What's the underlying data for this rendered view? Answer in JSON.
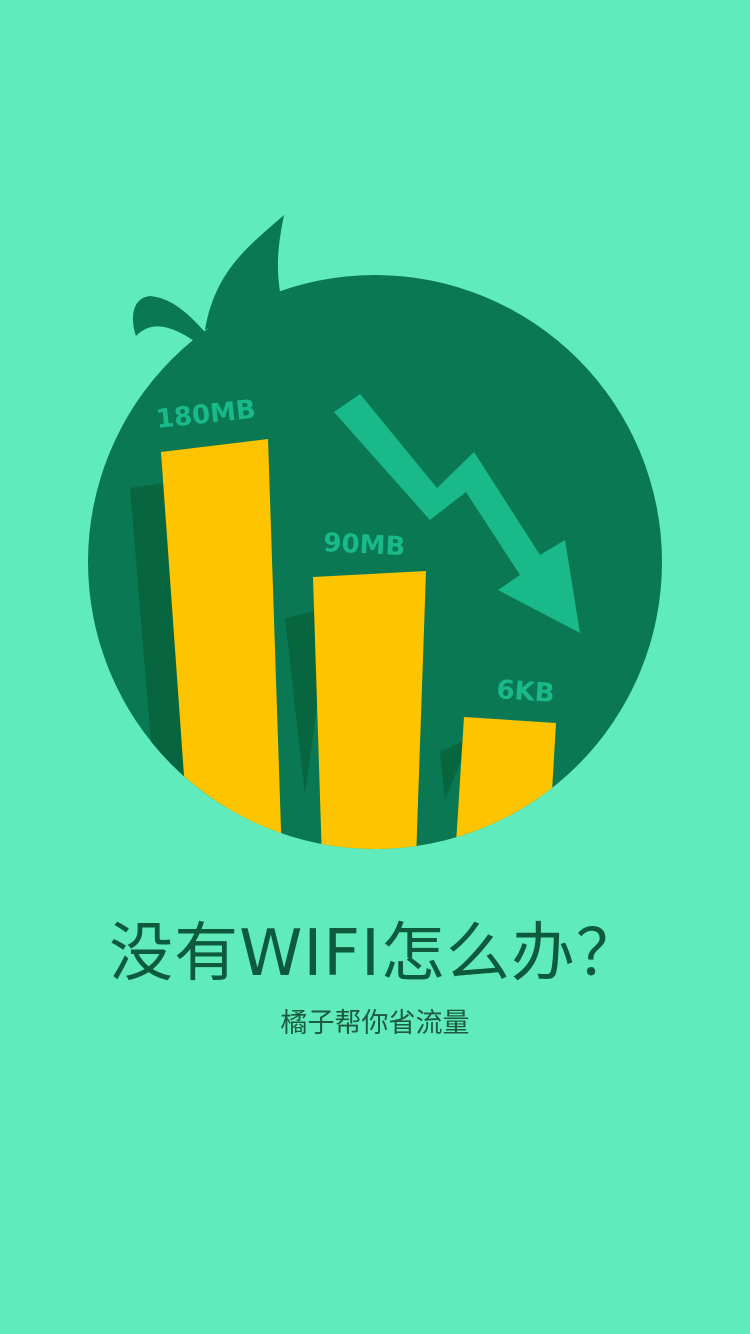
{
  "colors": {
    "background": "#60ebbd",
    "circle": "#0a7852",
    "circle_shadow": "#07663f",
    "bar": "#ffc400",
    "arrow": "#1ab98a",
    "label": "#1ab98a",
    "headline": "#0e5a3c"
  },
  "illustration": {
    "icons": [
      "orange-fruit-icon",
      "trend-down-arrow-icon"
    ],
    "bars": [
      {
        "label": "180MB"
      },
      {
        "label": "90MB"
      },
      {
        "label": "6KB"
      }
    ]
  },
  "headline": "没有WIFI怎么办？",
  "subline": "橘子帮你省流量"
}
